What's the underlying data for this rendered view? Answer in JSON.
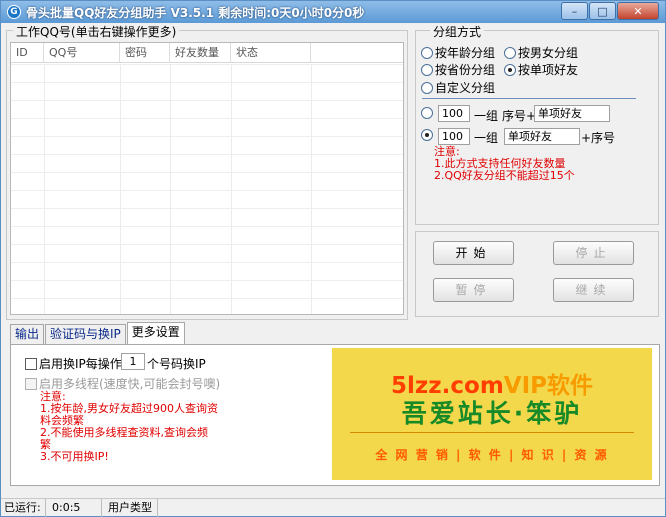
{
  "window": {
    "title": "骨头批量QQ好友分组助手 V3.5.1 剩余时间:0天0小时0分0秒",
    "controls": {
      "minimize": "–",
      "maximize": "□",
      "close": "✕"
    }
  },
  "left_panel": {
    "label": "工作QQ号(单击右键操作更多)",
    "columns": [
      "ID",
      "QQ号",
      "密码",
      "好友数量",
      "状态"
    ]
  },
  "grouping": {
    "label": "分组方式",
    "options": [
      {
        "label": "按年龄分组",
        "checked": false
      },
      {
        "label": "按男女分组",
        "checked": false
      },
      {
        "label": "按省份分组",
        "checked": false
      },
      {
        "label": "按单项好友",
        "checked": true
      },
      {
        "label": "自定义分组",
        "checked": false
      }
    ],
    "row1": {
      "value": "100",
      "per_group": "一组",
      "prefix_label": "序号+",
      "name_value": "单项好友",
      "checked": false
    },
    "row2": {
      "value": "100",
      "per_group": "一组",
      "name_value": "单项好友",
      "suffix_label": "+序号",
      "checked": true
    },
    "notes": [
      "注意:",
      "1.此方式支持任何好友数量",
      "2.QQ好友分组不能超过15个"
    ]
  },
  "actions": {
    "start": "开始",
    "stop": "停止",
    "pause": "暂停",
    "resume": "继续"
  },
  "tabs": [
    "输出",
    "验证码与换IP",
    "更多设置"
  ],
  "settings": {
    "ip_switch_label": "启用换IP每操作",
    "ip_switch_count": "1",
    "ip_switch_suffix": "个号码换IP",
    "multithread_label": "启用多线程(速度快,可能会封号噢)",
    "notes": [
      "注意:",
      "1.按年龄,男女好友超过900人查询资",
      "料会频繁",
      "2.不能使用多线程查资料,查询会频",
      "繁",
      "3.不可用换IP!"
    ]
  },
  "banner": {
    "site": "5lzz.com",
    "vip": "VIP软件",
    "main": "吾爱站长·笨驴",
    "tagline": "全 网 营 销 | 软 件 | 知 识 | 资 源"
  },
  "status": {
    "running_label": "已运行:",
    "running_time": "0:0:5",
    "user_type_label": "用户类型"
  }
}
